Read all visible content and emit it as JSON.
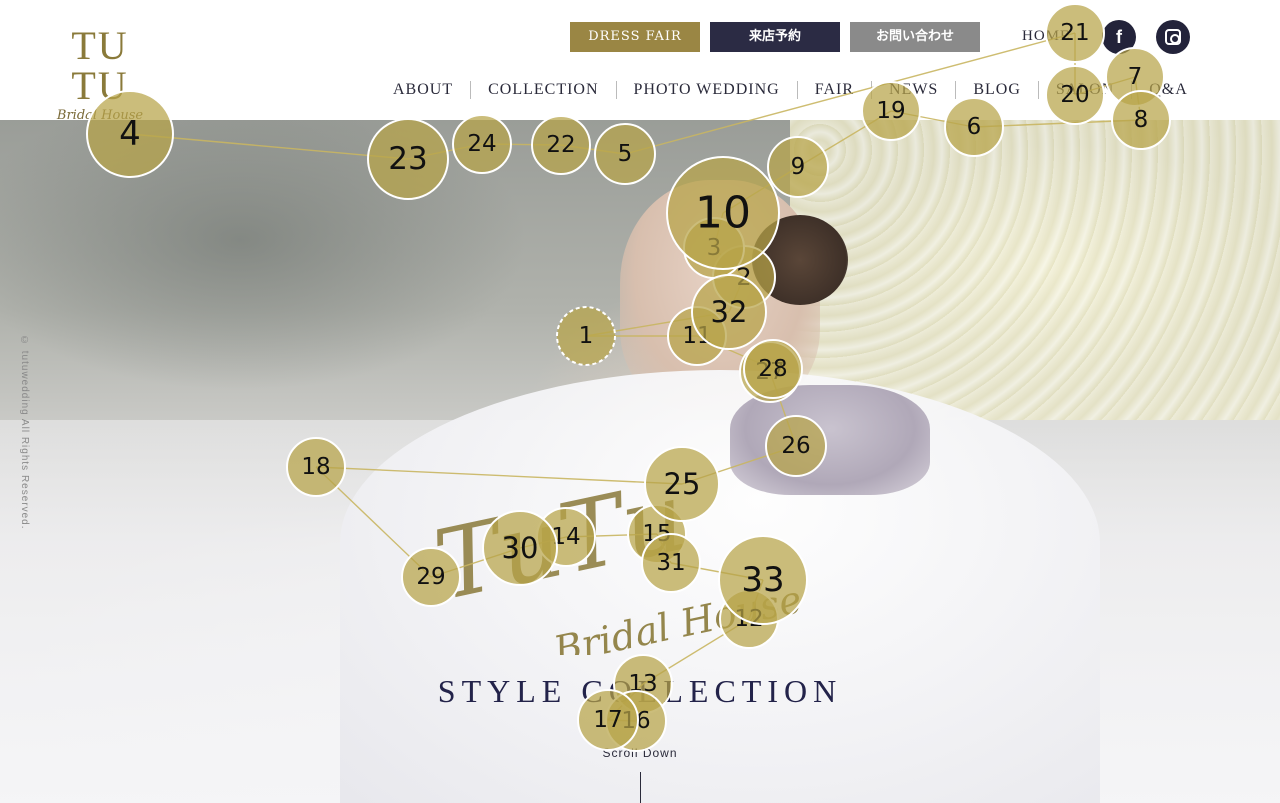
{
  "header": {
    "logo_word": "TU TU",
    "logo_sub": "Bridal House",
    "buttons": {
      "dress_fair": "DRESS FAIR",
      "visit_reservation": "来店予約",
      "contact": "お問い合わせ"
    },
    "home": "HOME",
    "social": {
      "facebook": "f",
      "instagram": "instagram"
    },
    "nav": [
      "ABOUT",
      "COLLECTION",
      "PHOTO WEDDING",
      "FAIR",
      "NEWS",
      "BLOG",
      "SALON",
      "Q&A"
    ]
  },
  "hero": {
    "script_logo_main": "TuTu",
    "script_logo_sub": "Bridal House",
    "title": "STYLE COLLECTION",
    "scroll_label": "Scroll Down",
    "copyright": "© tutuwedding All Rights Reserved."
  },
  "overlay": {
    "marker_color": "#b7a448",
    "line_color": "#c9b662",
    "markers": [
      {
        "label": "1"
      },
      {
        "label": "2"
      },
      {
        "label": "3"
      },
      {
        "label": "4"
      },
      {
        "label": "5"
      },
      {
        "label": "6"
      },
      {
        "label": "7"
      },
      {
        "label": "8"
      },
      {
        "label": "9"
      },
      {
        "label": "10"
      },
      {
        "label": "11"
      },
      {
        "label": "12"
      },
      {
        "label": "13"
      },
      {
        "label": "14"
      },
      {
        "label": "15"
      },
      {
        "label": "16"
      },
      {
        "label": "17"
      },
      {
        "label": "18"
      },
      {
        "label": "19"
      },
      {
        "label": "20"
      },
      {
        "label": "21"
      },
      {
        "label": "22"
      },
      {
        "label": "23"
      },
      {
        "label": "24"
      },
      {
        "label": "25"
      },
      {
        "label": "26"
      },
      {
        "label": "27"
      },
      {
        "label": "28"
      },
      {
        "label": "29"
      },
      {
        "label": "30"
      },
      {
        "label": "31"
      },
      {
        "label": "32"
      },
      {
        "label": "33"
      }
    ]
  }
}
